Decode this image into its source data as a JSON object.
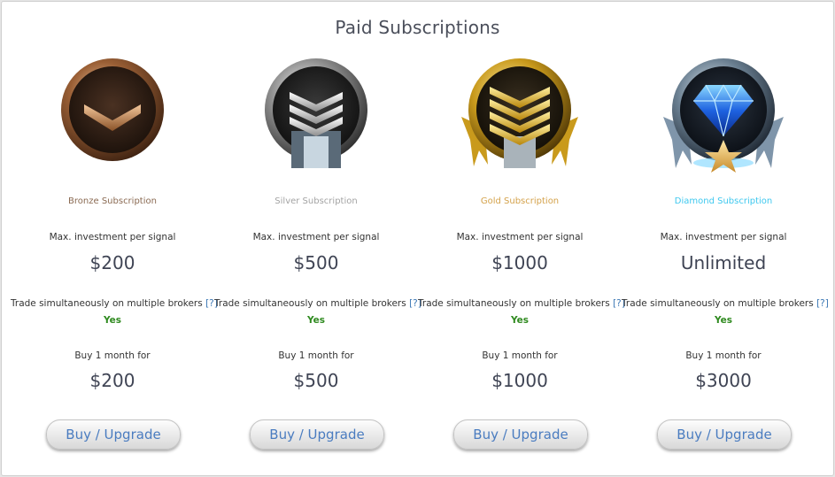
{
  "page": {
    "title": "Paid Subscriptions"
  },
  "plans": [
    {
      "name": "Bronze Subscription",
      "name_color": "#8a6a52",
      "icon": "bronze-chevron-badge-icon",
      "max_label": "Max. investment per signal",
      "max_value": "$200",
      "trade_label": "Trade simultaneously on multiple brokers",
      "help": "[?]",
      "trade_value": "Yes",
      "buy_label": "Buy 1 month for",
      "price": "$200",
      "button": "Buy / Upgrade"
    },
    {
      "name": "Silver Subscription",
      "name_color": "#a3a3a3",
      "icon": "silver-chevron-badge-icon",
      "max_label": "Max. investment per signal",
      "max_value": "$500",
      "trade_label": "Trade simultaneously on multiple brokers",
      "help": "[?]",
      "trade_value": "Yes",
      "buy_label": "Buy 1 month for",
      "price": "$500",
      "button": "Buy / Upgrade"
    },
    {
      "name": "Gold Subscription",
      "name_color": "#d4a24b",
      "icon": "gold-chevron-badge-icon",
      "max_label": "Max. investment per signal",
      "max_value": "$1000",
      "trade_label": "Trade simultaneously on multiple brokers",
      "help": "[?]",
      "trade_value": "Yes",
      "buy_label": "Buy 1 month for",
      "price": "$1000",
      "button": "Buy / Upgrade"
    },
    {
      "name": "Diamond Subscription",
      "name_color": "#3ec8ef",
      "icon": "diamond-star-badge-icon",
      "max_label": "Max. investment per signal",
      "max_value": "Unlimited",
      "trade_label": "Trade simultaneously on multiple brokers",
      "help": "[?]",
      "trade_value": "Yes",
      "buy_label": "Buy 1 month for",
      "price": "$3000",
      "button": "Buy / Upgrade"
    }
  ],
  "colors": {
    "help_link": "#3c78b5",
    "yes": "#2f8a1f",
    "button_text": "#4a7cc0"
  }
}
